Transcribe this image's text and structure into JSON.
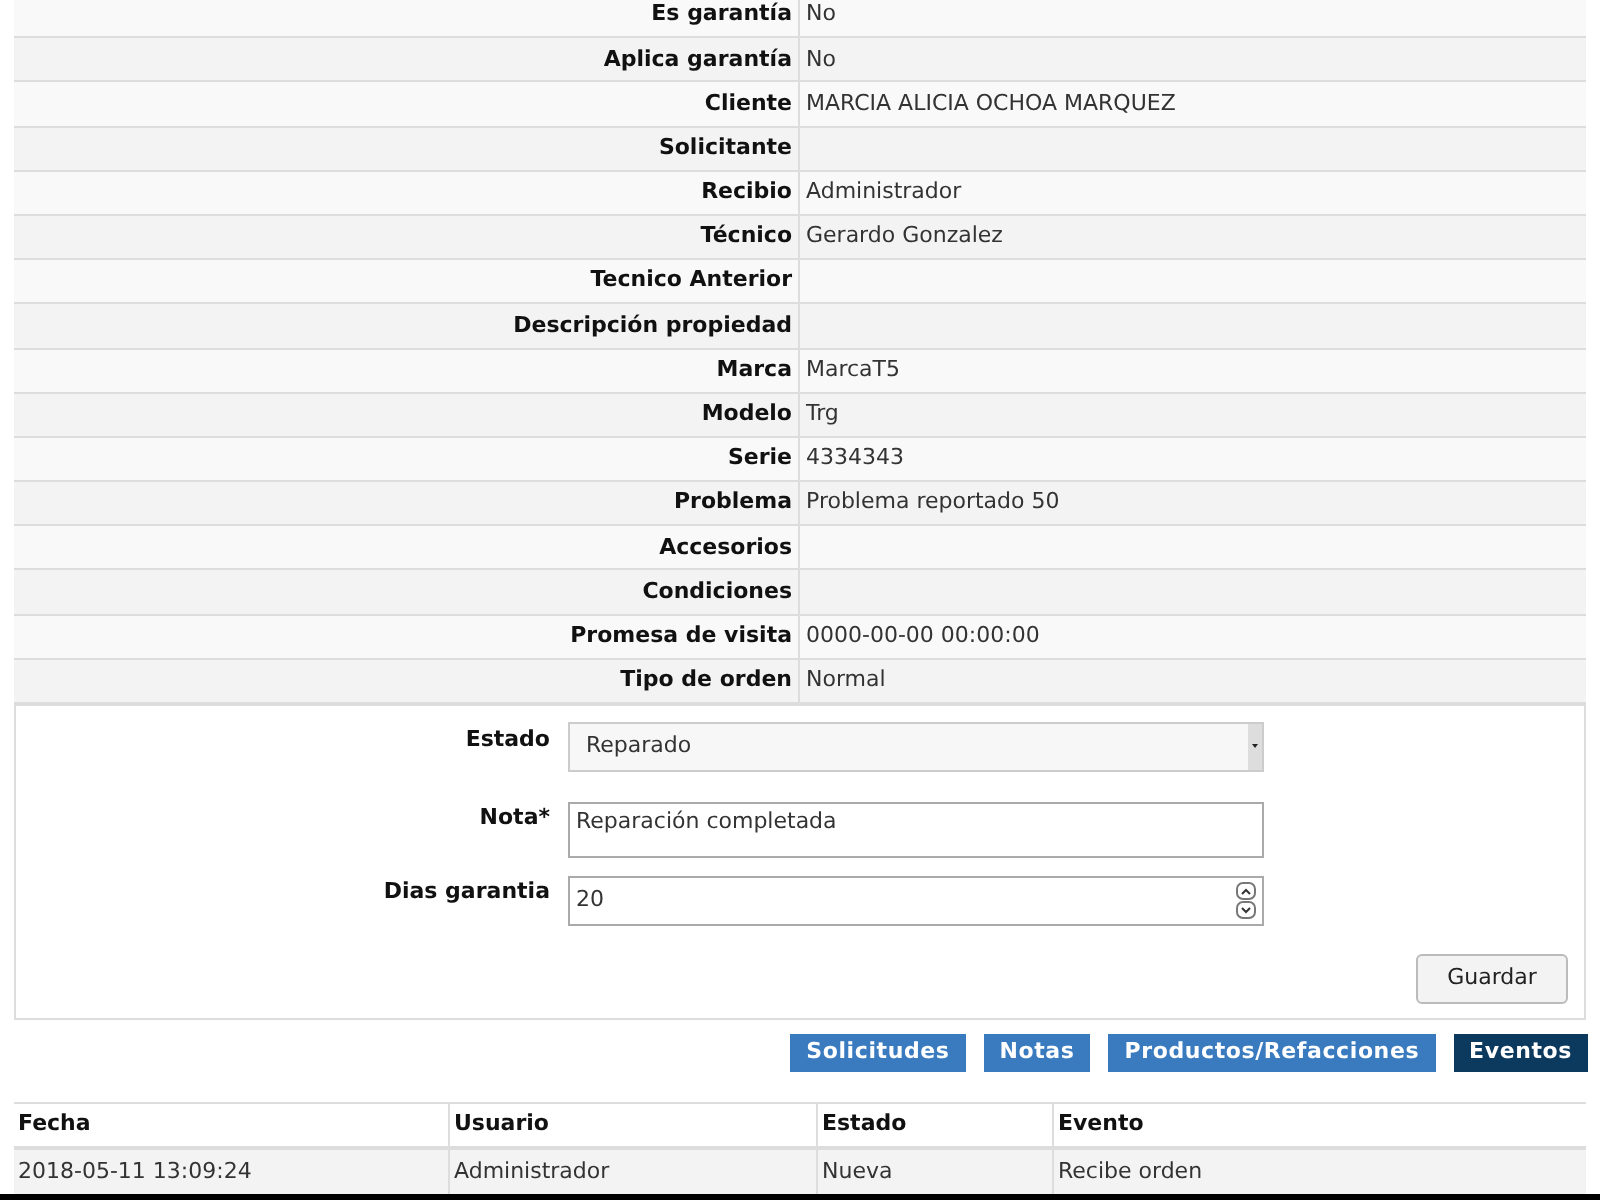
{
  "details": [
    {
      "label": "Es garantía",
      "value": "No"
    },
    {
      "label": "Aplica garantía",
      "value": "No"
    },
    {
      "label": "Cliente",
      "value": "MARCIA ALICIA OCHOA MARQUEZ"
    },
    {
      "label": "Solicitante"
    },
    {
      "label": "Recibio",
      "value": "Administrador"
    },
    {
      "label": "Técnico",
      "value": "Gerardo Gonzalez"
    },
    {
      "label": "Tecnico Anterior"
    },
    {
      "label": "Descripción propiedad"
    },
    {
      "label": "Marca",
      "value": "MarcaT5"
    },
    {
      "label": "Modelo",
      "value": "Trg"
    },
    {
      "label": "Serie",
      "value": "4334343"
    },
    {
      "label": "Problema",
      "value": "Problema reportado 50"
    },
    {
      "label": "Accesorios"
    },
    {
      "label": "Condiciones"
    },
    {
      "label": "Promesa de visita",
      "value": "0000-00-00 00:00:00"
    },
    {
      "label": "Tipo de orden",
      "value": "Normal"
    }
  ],
  "form": {
    "estado": {
      "label": "Estado",
      "value": "Reparado"
    },
    "nota": {
      "label": "Nota*",
      "value": "Reparación completada"
    },
    "dias_garantia": {
      "label": "Dias garantia",
      "value": "20"
    },
    "save_button": "Guardar"
  },
  "tabs": [
    {
      "label": "Solicitudes",
      "selected": false
    },
    {
      "label": "Notas",
      "selected": false
    },
    {
      "label": "Productos/Refacciones",
      "selected": false
    },
    {
      "label": "Eventos",
      "selected": true
    }
  ],
  "events_table": {
    "columns": [
      "Fecha",
      "Usuario",
      "Estado",
      "Evento"
    ],
    "rows": [
      [
        "2018-05-11 13:09:24",
        "Administrador",
        "Nueva",
        "Recibe orden"
      ]
    ]
  }
}
